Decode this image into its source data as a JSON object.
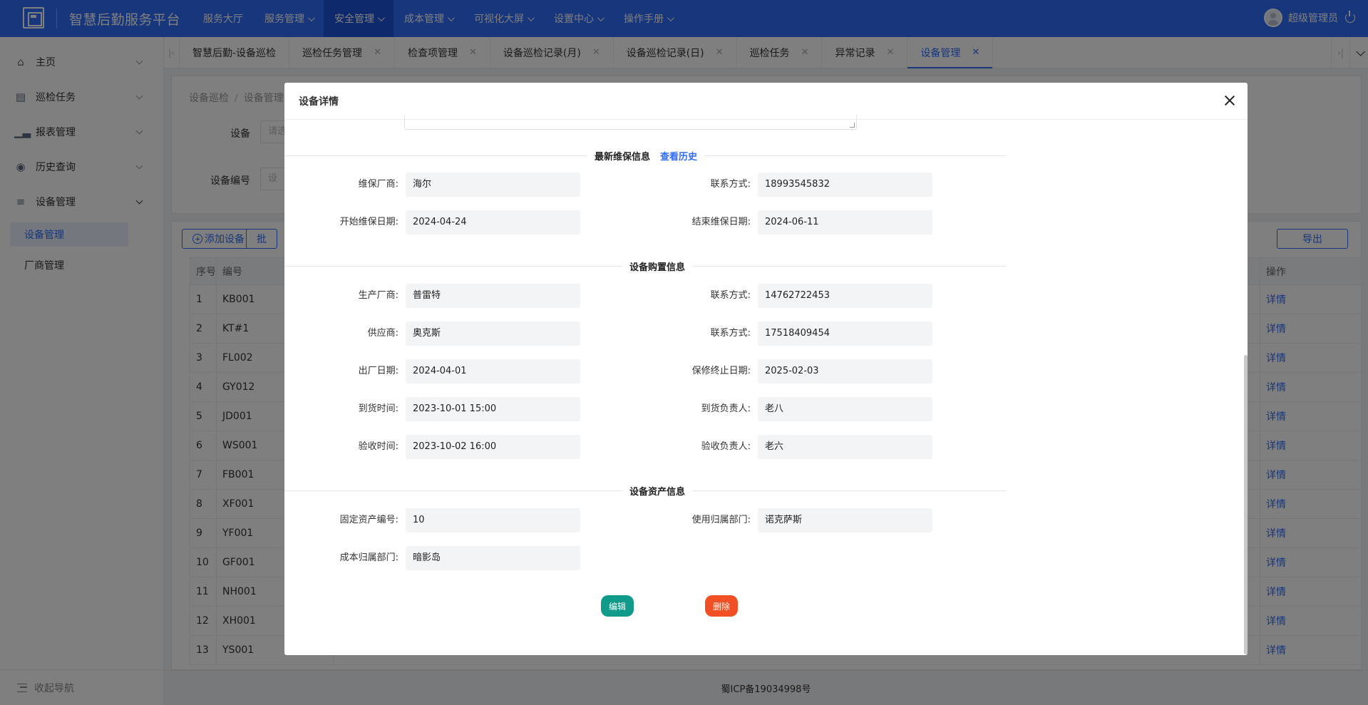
{
  "app": {
    "title": "智慧后勤服务平台"
  },
  "topnav": {
    "items": [
      {
        "label": "服务大厅",
        "has_menu": false
      },
      {
        "label": "服务管理",
        "has_menu": true
      },
      {
        "label": "安全管理",
        "has_menu": true,
        "active": true
      },
      {
        "label": "成本管理",
        "has_menu": true
      },
      {
        "label": "可视化大屏",
        "has_menu": true
      },
      {
        "label": "设置中心",
        "has_menu": true
      },
      {
        "label": "操作手册",
        "has_menu": true
      }
    ],
    "user_name": "超级管理员"
  },
  "sidebar": {
    "items": [
      {
        "label": "主页",
        "icon": "home-icon"
      },
      {
        "label": "巡检任务",
        "icon": "task-icon"
      },
      {
        "label": "报表管理",
        "icon": "chart-icon"
      },
      {
        "label": "历史查询",
        "icon": "history-icon"
      },
      {
        "label": "设备管理",
        "icon": "device-icon",
        "open": true
      }
    ],
    "sub_items": [
      {
        "label": "设备管理",
        "active": true
      },
      {
        "label": "厂商管理",
        "active": false
      }
    ],
    "collapse_label": "收起导航"
  },
  "tabs": [
    {
      "label": "智慧后勤-设备巡检",
      "closable": false
    },
    {
      "label": "巡检任务管理",
      "closable": true
    },
    {
      "label": "检查项管理",
      "closable": true
    },
    {
      "label": "设备巡检记录(月)",
      "closable": true
    },
    {
      "label": "设备巡检记录(日)",
      "closable": true
    },
    {
      "label": "巡检任务",
      "closable": true
    },
    {
      "label": "异常记录",
      "closable": true
    },
    {
      "label": "设备管理",
      "closable": true,
      "active": true
    }
  ],
  "breadcrumb": {
    "parent": "设备巡检",
    "current": "设备管理"
  },
  "filters": {
    "device_label": "设备",
    "device_placeholder": "请选",
    "code_label": "设备编号",
    "code_placeholder": "设"
  },
  "list": {
    "add_button": "添加设备",
    "batch_button": "批",
    "export_button": "导出",
    "columns": {
      "index": "序号",
      "code": "编号",
      "ops": "操作"
    },
    "rows": [
      {
        "index": "1",
        "code": "KB001",
        "op": "详情"
      },
      {
        "index": "2",
        "code": "KT#1",
        "op": "详情"
      },
      {
        "index": "3",
        "code": "FL002",
        "op": "详情"
      },
      {
        "index": "4",
        "code": "GY012",
        "op": "详情"
      },
      {
        "index": "5",
        "code": "JD001",
        "op": "详情"
      },
      {
        "index": "6",
        "code": "WS001",
        "op": "详情"
      },
      {
        "index": "7",
        "code": "FB001",
        "op": "详情"
      },
      {
        "index": "8",
        "code": "XF001",
        "op": "详情"
      },
      {
        "index": "9",
        "code": "YF001",
        "op": "详情"
      },
      {
        "index": "10",
        "code": "GF001",
        "op": "详情"
      },
      {
        "index": "11",
        "code": "NH001",
        "op": "详情"
      },
      {
        "index": "12",
        "code": "XH001",
        "op": "详情"
      },
      {
        "index": "13",
        "code": "YS001",
        "op": "详情"
      }
    ]
  },
  "footer": {
    "icp": "蜀ICP备19034998号"
  },
  "modal": {
    "title": "设备详情",
    "maintenance": {
      "section_title": "最新维保信息",
      "history_link": "查看历史",
      "vendor_label": "维保厂商:",
      "vendor": "海尔",
      "contact_label": "联系方式:",
      "contact": "18993545832",
      "start_label": "开始维保日期:",
      "start": "2024-04-24",
      "end_label": "结束维保日期:",
      "end": "2024-06-11"
    },
    "purchase": {
      "section_title": "设备购置信息",
      "manufacturer_label": "生产厂商:",
      "manufacturer": "普雷特",
      "manufacturer_contact_label": "联系方式:",
      "manufacturer_contact": "14762722453",
      "supplier_label": "供应商:",
      "supplier": "奥克斯",
      "supplier_contact_label": "联系方式:",
      "supplier_contact": "17518409454",
      "factory_date_label": "出厂日期:",
      "factory_date": "2024-04-01",
      "warranty_end_label": "保修终止日期:",
      "warranty_end": "2025-02-03",
      "arrival_time_label": "到货时间:",
      "arrival_time": "2023-10-01 15:00",
      "arrival_person_label": "到货负责人:",
      "arrival_person": "老八",
      "acceptance_time_label": "验收时间:",
      "acceptance_time": "2023-10-02 16:00",
      "acceptance_person_label": "验收负责人:",
      "acceptance_person": "老六"
    },
    "asset": {
      "section_title": "设备资产信息",
      "asset_no_label": "固定资产编号:",
      "asset_no": "10",
      "use_dept_label": "使用归属部门:",
      "use_dept": "诺克萨斯",
      "cost_dept_label": "成本归属部门:",
      "cost_dept": "暗影岛"
    },
    "edit_button": "编辑",
    "delete_button": "删除"
  },
  "colors": {
    "primary": "#2f6cf6",
    "edit": "#0f9a8a",
    "delete": "#f05023"
  }
}
